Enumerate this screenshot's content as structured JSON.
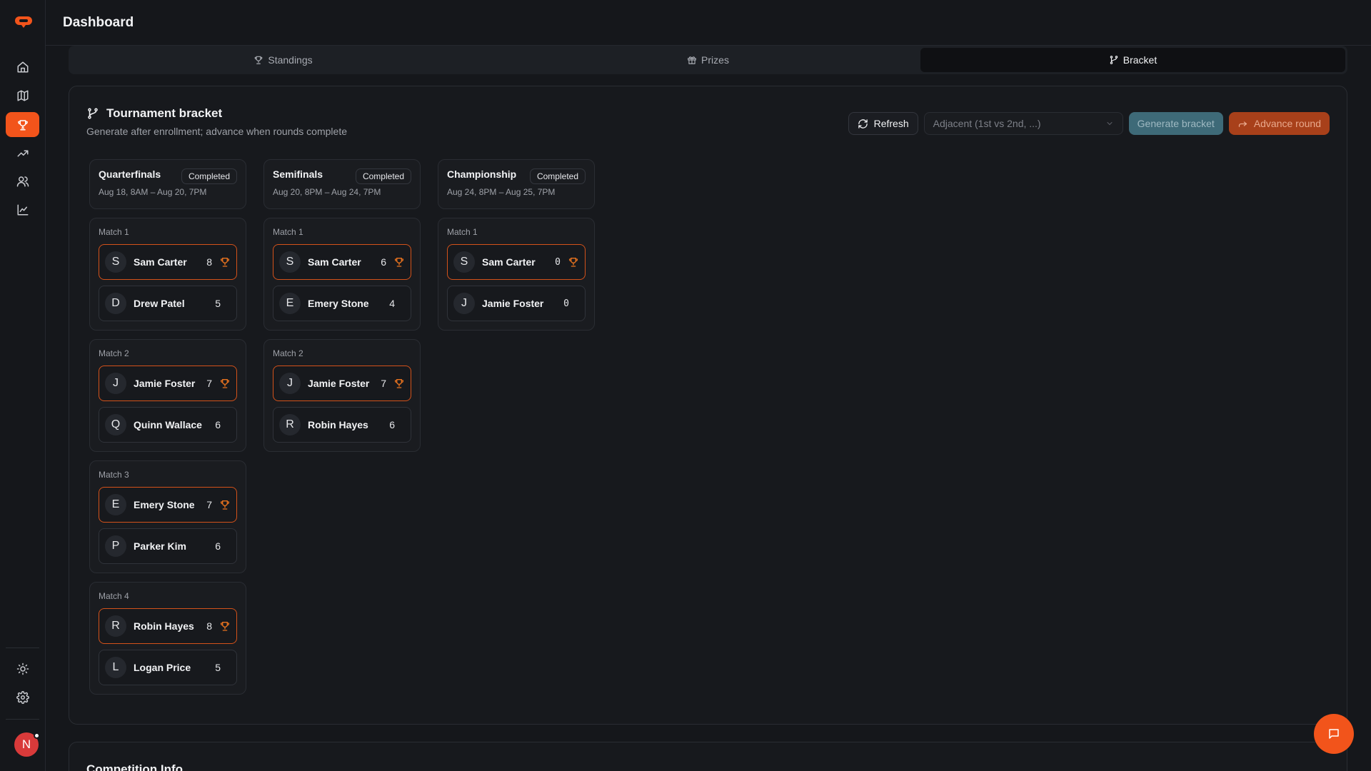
{
  "header": {
    "title": "Dashboard"
  },
  "sidebar": {
    "items": [
      {
        "name": "home",
        "icon": "home-icon"
      },
      {
        "name": "map",
        "icon": "map-icon"
      },
      {
        "name": "trophy",
        "icon": "trophy-icon",
        "active": true
      },
      {
        "name": "trending",
        "icon": "trending-up-icon"
      },
      {
        "name": "users",
        "icon": "users-icon"
      },
      {
        "name": "analytics",
        "icon": "line-chart-icon"
      }
    ],
    "bottom": [
      {
        "name": "theme",
        "icon": "sun-icon"
      },
      {
        "name": "settings",
        "icon": "gear-icon"
      }
    ],
    "avatar_initial": "N"
  },
  "tabs": [
    {
      "label": "Standings",
      "icon": "trophy-icon"
    },
    {
      "label": "Prizes",
      "icon": "gift-icon"
    },
    {
      "label": "Bracket",
      "icon": "git-fork-icon",
      "active": true
    }
  ],
  "bracket": {
    "title": "Tournament bracket",
    "subtitle": "Generate after enrollment; advance when rounds complete",
    "refresh_label": "Refresh",
    "pairing_select_value": "Adjacent (1st vs 2nd, ...)",
    "generate_label": "Generate bracket",
    "advance_label": "Advance round",
    "rounds": [
      {
        "name": "Quarterfinals",
        "status": "Completed",
        "dates": "Aug 18, 8AM – Aug 20, 7PM",
        "matches": [
          {
            "label": "Match 1",
            "players": [
              {
                "initial": "S",
                "name": "Sam Carter",
                "score": "8",
                "winner": true
              },
              {
                "initial": "D",
                "name": "Drew Patel",
                "score": "5",
                "winner": false
              }
            ]
          },
          {
            "label": "Match 2",
            "players": [
              {
                "initial": "J",
                "name": "Jamie Foster",
                "score": "7",
                "winner": true
              },
              {
                "initial": "Q",
                "name": "Quinn Wallace",
                "score": "6",
                "winner": false
              }
            ]
          },
          {
            "label": "Match 3",
            "players": [
              {
                "initial": "E",
                "name": "Emery Stone",
                "score": "7",
                "winner": true
              },
              {
                "initial": "P",
                "name": "Parker Kim",
                "score": "6",
                "winner": false
              }
            ]
          },
          {
            "label": "Match 4",
            "players": [
              {
                "initial": "R",
                "name": "Robin Hayes",
                "score": "8",
                "winner": true
              },
              {
                "initial": "L",
                "name": "Logan Price",
                "score": "5",
                "winner": false
              }
            ]
          }
        ]
      },
      {
        "name": "Semifinals",
        "status": "Completed",
        "dates": "Aug 20, 8PM – Aug 24, 7PM",
        "matches": [
          {
            "label": "Match 1",
            "players": [
              {
                "initial": "S",
                "name": "Sam Carter",
                "score": "6",
                "winner": true
              },
              {
                "initial": "E",
                "name": "Emery Stone",
                "score": "4",
                "winner": false
              }
            ]
          },
          {
            "label": "Match 2",
            "players": [
              {
                "initial": "J",
                "name": "Jamie Foster",
                "score": "7",
                "winner": true
              },
              {
                "initial": "R",
                "name": "Robin Hayes",
                "score": "6",
                "winner": false
              }
            ]
          }
        ]
      },
      {
        "name": "Championship",
        "status": "Completed",
        "dates": "Aug 24, 8PM – Aug 25, 7PM",
        "matches": [
          {
            "label": "Match 1",
            "players": [
              {
                "initial": "S",
                "name": "Sam Carter",
                "score": "0",
                "winner": true
              },
              {
                "initial": "J",
                "name": "Jamie Foster",
                "score": "0",
                "winner": false
              }
            ]
          }
        ]
      }
    ]
  },
  "competition_info": {
    "title": "Competition Info"
  },
  "colors": {
    "accent": "#f2541b",
    "winner_border": "#d4521a",
    "background": "#15171b"
  }
}
